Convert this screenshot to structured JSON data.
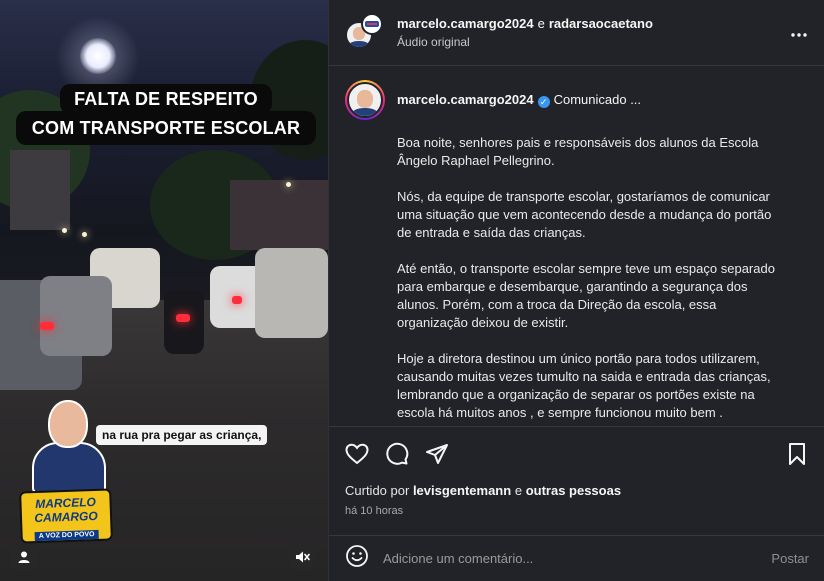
{
  "video": {
    "headline_line1": "FALTA DE RESPEITO",
    "headline_line2": "COM TRANSPORTE ESCOLAR",
    "subtitle": "na rua pra pegar as criança,",
    "badge_name_line1": "MARCELO",
    "badge_name_line2": "CAMARGO",
    "badge_slogan": "A VOZ DO POVO"
  },
  "header": {
    "author": "marcelo.camargo2024",
    "connector": "e",
    "coauthor": "radarsaocaetano",
    "audio": "Áudio original",
    "more_icon": "more-horizontal-icon"
  },
  "caption": {
    "username": "marcelo.camargo2024",
    "first_line": "Comunicado ...",
    "paragraphs": [
      "Boa noite, senhores pais e responsáveis dos alunos da Escola Ângelo Raphael Pellegrino.",
      "Nós, da equipe de transporte escolar, gostaríamos de comunicar uma situação que vem acontecendo desde a mudança do portão de entrada e saída das crianças.",
      "Até então, o transporte escolar sempre teve um espaço separado para embarque e desembarque, garantindo a segurança dos alunos. Porém, com a troca da Direção da escola, essa organização deixou de existir.",
      "Hoje a diretora destinou um único portão para todos utilizarem, causando muitas vezes tumulto na saida e entrada das crianças, lembrando que a organização de separar os portões existe na escola há muitos anos , e sempre funcionou muito bem ."
    ]
  },
  "actions": {
    "liked_by_prefix": "Curtido por",
    "liked_by_user": "levisgentemann",
    "liked_by_connector": "e",
    "liked_by_others": "outras pessoas",
    "time": "há 10 horas"
  },
  "comment": {
    "placeholder": "Adicione um comentário...",
    "post_label": "Postar"
  },
  "colors": {
    "panel_bg": "#212328",
    "verified": "#3897f0",
    "badge_yellow": "#f3c51a"
  }
}
